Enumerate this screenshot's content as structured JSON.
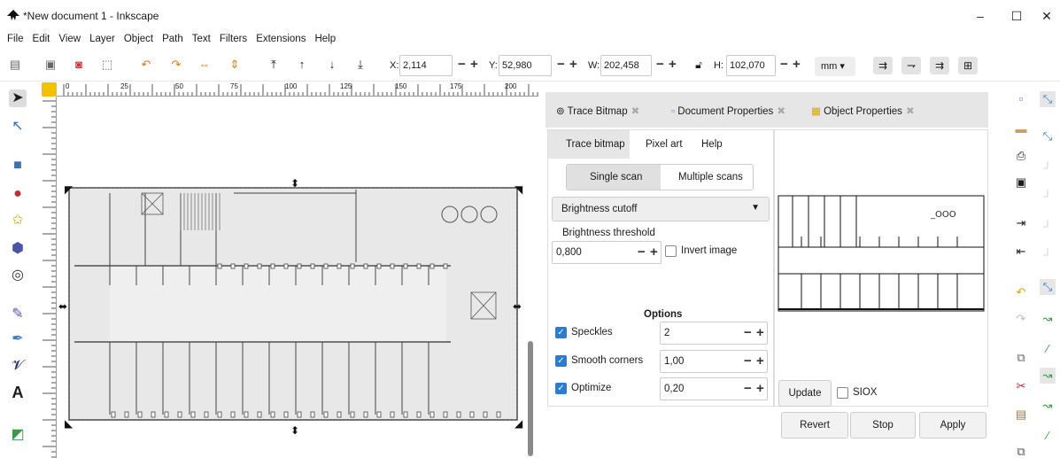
{
  "window": {
    "title": "*New document 1 - Inkscape",
    "minimize": "–",
    "maximize": "☐",
    "close": "✕"
  },
  "menu": [
    "File",
    "Edit",
    "View",
    "Layer",
    "Object",
    "Path",
    "Text",
    "Filters",
    "Extensions",
    "Help"
  ],
  "toolbar": {
    "x_label": "X:",
    "x_value": "2,114",
    "y_label": "Y:",
    "y_value": "52,980",
    "w_label": "W:",
    "w_value": "202,458",
    "h_label": "H:",
    "h_value": "102,070",
    "unit": "mm"
  },
  "ruler": {
    "ticks": [
      "0",
      "25",
      "50",
      "75",
      "100",
      "125",
      "150",
      "175",
      "200"
    ]
  },
  "dock_tabs": [
    {
      "label": "Trace Bitmap",
      "icon": "trace-bitmap-icon"
    },
    {
      "label": "Document Properties",
      "icon": "document-properties-icon"
    },
    {
      "label": "Object Properties",
      "icon": "object-properties-icon"
    }
  ],
  "trace": {
    "subtabs": [
      "Trace bitmap",
      "Pixel art",
      "Help"
    ],
    "scan_modes": [
      "Single scan",
      "Multiple scans"
    ],
    "mode": "Brightness cutoff",
    "threshold_label": "Brightness threshold",
    "threshold_value": "0,800",
    "invert_label": "Invert image",
    "options_label": "Options",
    "speckles_label": "Speckles",
    "speckles_value": "2",
    "smooth_label": "Smooth corners",
    "smooth_value": "1,00",
    "optimize_label": "Optimize",
    "optimize_value": "0,20",
    "update": "Update",
    "siox": "SIOX",
    "revert": "Revert",
    "stop": "Stop",
    "apply": "Apply"
  },
  "colors": {
    "accent": "#2a7dd4",
    "lock": "#f2c200"
  }
}
